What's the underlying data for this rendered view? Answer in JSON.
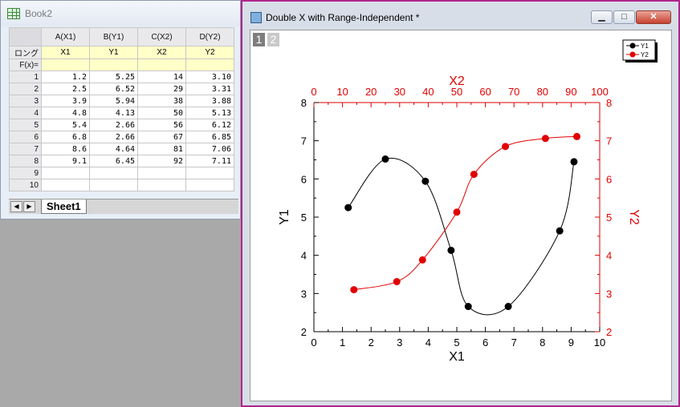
{
  "book": {
    "title": "Book2",
    "columns": [
      "A(X1)",
      "B(Y1)",
      "C(X2)",
      "D(Y2)"
    ],
    "longname_label": "ロング",
    "longnames": [
      "X1",
      "Y1",
      "X2",
      "Y2"
    ],
    "fx_label": "F(x)=",
    "row_numbers": [
      "1",
      "2",
      "3",
      "4",
      "5",
      "6",
      "7",
      "8",
      "9",
      "10"
    ],
    "rows": [
      [
        "1.2",
        "5.25",
        "14",
        "3.10"
      ],
      [
        "2.5",
        "6.52",
        "29",
        "3.31"
      ],
      [
        "3.9",
        "5.94",
        "38",
        "3.88"
      ],
      [
        "4.8",
        "4.13",
        "50",
        "5.13"
      ],
      [
        "5.4",
        "2.66",
        "56",
        "6.12"
      ],
      [
        "6.8",
        "2.66",
        "67",
        "6.85"
      ],
      [
        "8.6",
        "4.64",
        "81",
        "7.06"
      ],
      [
        "9.1",
        "6.45",
        "92",
        "7.11"
      ],
      [
        "",
        "",
        "",
        ""
      ],
      [
        "",
        "",
        "",
        ""
      ]
    ],
    "sheet_tab": "Sheet1",
    "nav_prev": "◀",
    "nav_next": "▶"
  },
  "graph": {
    "title": "Double X with Range-Independent *",
    "layers": [
      "1",
      "2"
    ],
    "buttons": {
      "minimize": "▁",
      "maximize": "□",
      "close": "✕"
    }
  },
  "chart_data": {
    "type": "line",
    "colors": {
      "series1": "#000000",
      "series2": "#e00000"
    },
    "x_bottom": {
      "label": "X1",
      "range": [
        0,
        10
      ],
      "ticks": [
        "0",
        "1",
        "2",
        "3",
        "4",
        "5",
        "6",
        "7",
        "8",
        "9",
        "10"
      ]
    },
    "x_top": {
      "label": "X2",
      "range": [
        0,
        100
      ],
      "ticks": [
        "0",
        "10",
        "20",
        "30",
        "40",
        "50",
        "60",
        "70",
        "80",
        "90",
        "100"
      ]
    },
    "y_left": {
      "label": "Y1",
      "range": [
        2,
        8
      ],
      "ticks": [
        "2",
        "3",
        "4",
        "5",
        "6",
        "7",
        "8"
      ]
    },
    "y_right": {
      "label": "Y2",
      "range": [
        2,
        8
      ],
      "ticks": [
        "2",
        "3",
        "4",
        "5",
        "6",
        "7",
        "8"
      ]
    },
    "legend": {
      "placement": "top-right",
      "entries": [
        "Y1",
        "Y2"
      ]
    },
    "series": [
      {
        "name": "Y1",
        "axis_x": "bottom",
        "axis_y": "left",
        "x": [
          1.2,
          2.5,
          3.9,
          4.8,
          5.4,
          6.8,
          8.6,
          9.1
        ],
        "y": [
          5.25,
          6.52,
          5.94,
          4.13,
          2.66,
          2.66,
          4.64,
          6.45
        ]
      },
      {
        "name": "Y2",
        "axis_x": "top",
        "axis_y": "right",
        "x": [
          14,
          29,
          38,
          50,
          56,
          67,
          81,
          92
        ],
        "y": [
          3.1,
          3.31,
          3.88,
          5.13,
          6.12,
          6.85,
          7.06,
          7.11
        ]
      }
    ],
    "grid": false
  }
}
